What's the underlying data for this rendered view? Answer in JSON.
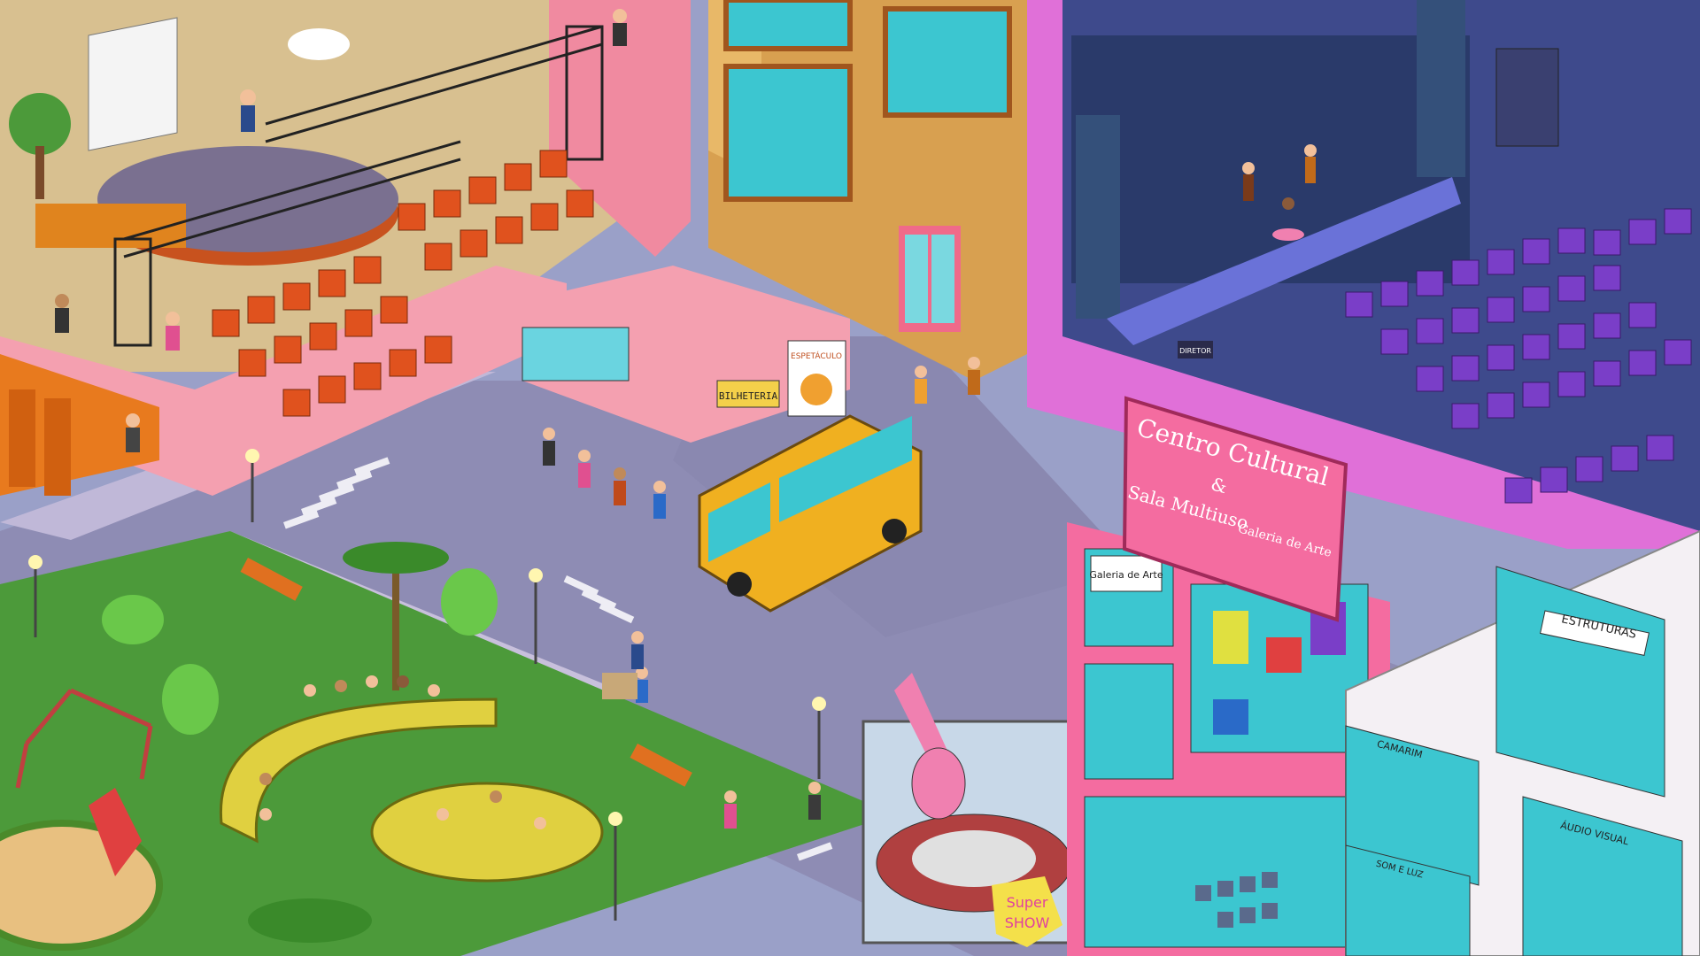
{
  "signs": {
    "centro_line1": "Centro Cultural",
    "centro_amp": "&",
    "centro_sala": "Sala Multiuso",
    "centro_galeria": "Galeria de Arte",
    "galeria_sign": "Galeria de Arte",
    "bilheteria": "BILHETERIA",
    "espetaculo": "ESPETÁCULO",
    "estruturas": "ESTRUTURAS",
    "camarim": "CAMARIM",
    "audio_visual": "ÁUDIO VISUAL",
    "som_luz": "SOM E LUZ",
    "diretor": "DIRETOR",
    "super": "Super",
    "show": "SHOW"
  },
  "colors": {
    "road": "#8e8cb4",
    "grass": "#4c9a3a",
    "plaza": "#d8c090",
    "pink_building": "#f08aa0",
    "theater_floor": "#3e4a8c",
    "seats_red": "#e0521e",
    "seats_purple": "#7a3ec8",
    "bus": "#f0b020",
    "gallery_pink": "#f46ca0"
  }
}
